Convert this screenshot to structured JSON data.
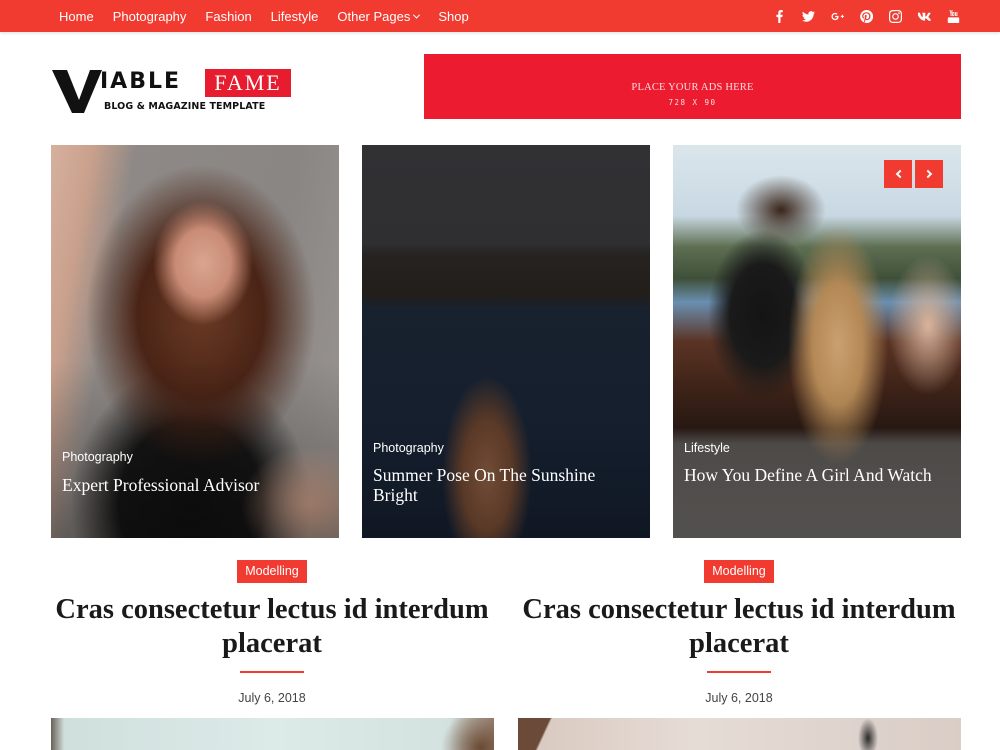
{
  "topbar": {
    "nav": [
      {
        "label": "Home"
      },
      {
        "label": "Photography"
      },
      {
        "label": "Fashion"
      },
      {
        "label": "Lifestyle"
      },
      {
        "label": "Other Pages",
        "has_dropdown": true
      },
      {
        "label": "Shop"
      }
    ],
    "social": [
      "facebook-icon",
      "twitter-icon",
      "google-plus-icon",
      "pinterest-icon",
      "instagram-icon",
      "vk-icon",
      "youtube-icon"
    ],
    "color": "#f13a30"
  },
  "header": {
    "logo": {
      "letter": "V",
      "word": "IABLE",
      "badge": "FAME",
      "tagline": "BLOG & MAGAZINE TEMPLATE",
      "badge_color": "#e71c2e"
    },
    "ad": {
      "title": "PLACE YOUR ADS HERE",
      "size": "728 X 90",
      "color": "#ed1b2f"
    }
  },
  "slider": {
    "cards": [
      {
        "category": "Photography",
        "title": "Expert Professional Advisor",
        "image": "woman-portrait"
      },
      {
        "category": "Photography",
        "title": "Summer Pose On The Sunshine Bright",
        "image": "woman-in-sea-splash"
      },
      {
        "category": "Lifestyle",
        "title": "How You Define A Girl And Watch",
        "image": "two-women-on-bench"
      }
    ],
    "prev_label": "‹",
    "next_label": "›"
  },
  "posts": [
    {
      "badge": "Modelling",
      "title": "Cras consectetur lectus id interdum placerat",
      "date": "July 6, 2018"
    },
    {
      "badge": "Modelling",
      "title": "Cras consectetur lectus id interdum placerat",
      "date": "July 6, 2018"
    }
  ],
  "accent_color": "#f13a30"
}
